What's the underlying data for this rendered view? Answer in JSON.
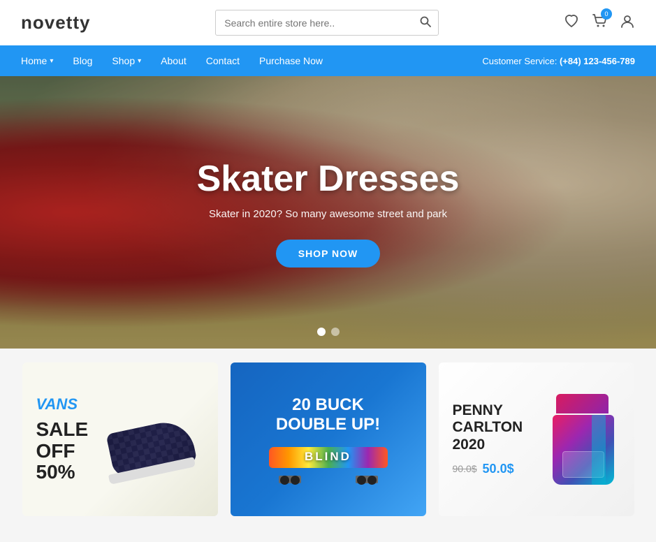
{
  "header": {
    "logo": "novetty",
    "search": {
      "placeholder": "Search entire store here..",
      "value": ""
    },
    "cart_count": "0",
    "icons": {
      "wishlist": "♡",
      "cart": "🛒",
      "user": "👤"
    }
  },
  "navbar": {
    "items": [
      {
        "label": "Home",
        "has_dropdown": true
      },
      {
        "label": "Blog",
        "has_dropdown": false
      },
      {
        "label": "Shop",
        "has_dropdown": true
      },
      {
        "label": "About",
        "has_dropdown": false
      },
      {
        "label": "Contact",
        "has_dropdown": false
      },
      {
        "label": "Purchase Now",
        "has_dropdown": false
      }
    ],
    "customer_service_label": "Customer Service:",
    "customer_service_phone": "(+84) 123-456-789"
  },
  "hero": {
    "title": "Skater Dresses",
    "subtitle": "Skater in 2020? So many awesome street and park",
    "cta_label": "SHOP NOW",
    "dots": [
      {
        "active": true
      },
      {
        "active": false
      }
    ]
  },
  "cards": [
    {
      "id": "vans",
      "brand": "VANS",
      "text": "SALE\nOFF\n50%"
    },
    {
      "id": "skate",
      "text": "20 BUCK\nDOUBLE UP!",
      "board_label": "BLIND"
    },
    {
      "id": "penny",
      "name": "PENNY\nCARLTON\n2020",
      "old_price": "90.0$",
      "new_price": "50.0$"
    }
  ]
}
